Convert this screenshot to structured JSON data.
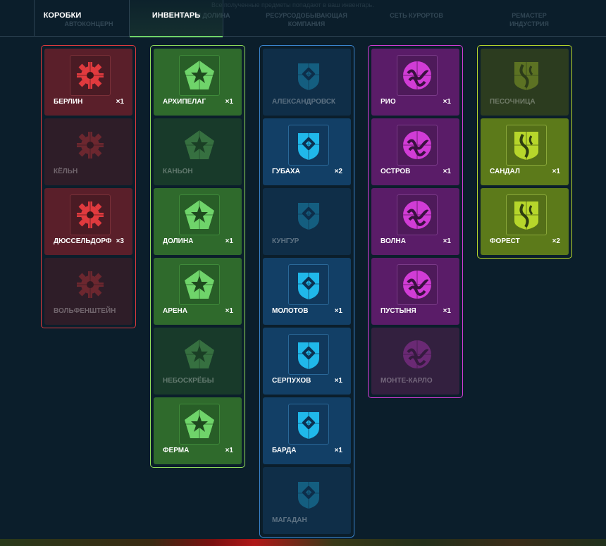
{
  "tabs": {
    "boxes_label": "КОРОБКИ",
    "inventory_label": "ИНВЕНТАРЬ"
  },
  "ghost_header": {
    "hint": "Все полученные предметы попадают в ваш инвентарь.",
    "categories": [
      "АВТОКОНЦЕРН",
      "ТАНКОВАЯ ДОЛИНА",
      "РЕСУРСОДОБЫВАЮЩАЯ КОМПАНИЯ",
      "СЕТЬ КУРОРТОВ",
      "РЕМАСТЕР ИНДУСТРИЯ"
    ]
  },
  "colors": {
    "red": "#e03a3e",
    "green": "#6fd46a",
    "blue": "#20b8ea",
    "purple": "#d13cd6",
    "olive": "#b6d62b"
  },
  "collections": [
    {
      "theme": "red",
      "icon": "gear-puzzle-icon",
      "items": [
        {
          "name": "БЕРЛИН",
          "qty": "×1",
          "owned": true
        },
        {
          "name": "КЁЛЬН",
          "qty": "",
          "owned": false
        },
        {
          "name": "ДЮССЕЛЬДОРФ",
          "qty": "×3",
          "owned": true
        },
        {
          "name": "ВОЛЬФЕНШТЕЙН",
          "qty": "",
          "owned": false
        }
      ]
    },
    {
      "theme": "green",
      "icon": "pentagon-puzzle-icon",
      "items": [
        {
          "name": "АРХИПЕЛАГ",
          "qty": "×1",
          "owned": true
        },
        {
          "name": "КАНЬОН",
          "qty": "",
          "owned": false
        },
        {
          "name": "ДОЛИНА",
          "qty": "×1",
          "owned": true
        },
        {
          "name": "АРЕНА",
          "qty": "×1",
          "owned": true
        },
        {
          "name": "НЕБОСКРЁБЫ",
          "qty": "",
          "owned": false
        },
        {
          "name": "ФЕРМА",
          "qty": "×1",
          "owned": true
        }
      ]
    },
    {
      "theme": "blue",
      "icon": "shield-puzzle-icon",
      "items": [
        {
          "name": "АЛЕКСАНДРОВСК",
          "qty": "",
          "owned": false
        },
        {
          "name": "ГУБАХА",
          "qty": "×2",
          "owned": true
        },
        {
          "name": "КУНГУР",
          "qty": "",
          "owned": false
        },
        {
          "name": "МОЛОТОВ",
          "qty": "×1",
          "owned": true
        },
        {
          "name": "СЕРПУХОВ",
          "qty": "×1",
          "owned": true
        },
        {
          "name": "БАРДА",
          "qty": "×1",
          "owned": true
        },
        {
          "name": "МАГАДАН",
          "qty": "",
          "owned": false
        }
      ]
    },
    {
      "theme": "purple",
      "icon": "wave-puzzle-icon",
      "items": [
        {
          "name": "РИО",
          "qty": "×1",
          "owned": true
        },
        {
          "name": "ОСТРОВ",
          "qty": "×1",
          "owned": true
        },
        {
          "name": "ВОЛНА",
          "qty": "×1",
          "owned": true
        },
        {
          "name": "ПУСТЫНЯ",
          "qty": "×1",
          "owned": true
        },
        {
          "name": "МОНТЕ-КАРЛО",
          "qty": "",
          "owned": false
        }
      ]
    },
    {
      "theme": "olive",
      "icon": "badge-puzzle-icon",
      "items": [
        {
          "name": "ПЕСОЧНИЦА",
          "qty": "",
          "owned": false
        },
        {
          "name": "САНДАЛ",
          "qty": "×1",
          "owned": true
        },
        {
          "name": "ФОРЕСТ",
          "qty": "×2",
          "owned": true
        }
      ]
    }
  ]
}
